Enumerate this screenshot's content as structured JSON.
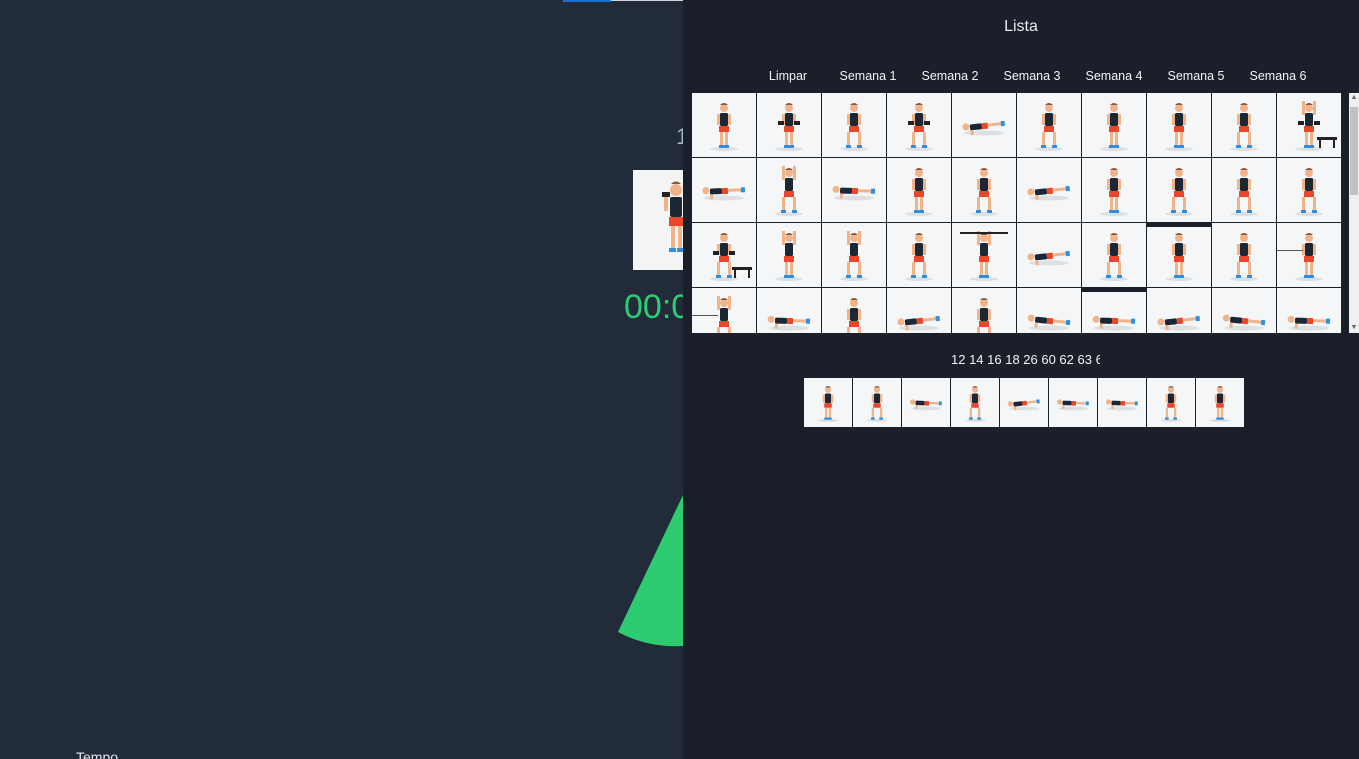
{
  "background": {
    "counter_text": "1",
    "timer_text": "00:0",
    "tempo_label": "Tempo",
    "accent_color": "#2ecc71"
  },
  "panel": {
    "title": "Lista",
    "week_tabs": [
      "Limpar",
      "Semana 1",
      "Semana 2",
      "Semana 3",
      "Semana 4",
      "Semana 5",
      "Semana 6"
    ],
    "selected_ids_text": "12 14 16 18 26 60 62 63 6",
    "exercise_grid": [
      [
        "squat-dumbbells",
        "sumo-squat",
        "shoulder-press",
        "weight-plate-squat",
        "floor-stretch",
        "dumbbell-side-raise",
        "kettlebell-squat",
        "one-arm-press",
        "arms-crossed-stand",
        "bench-step"
      ],
      [
        "crunch",
        "dumbbell-curl",
        "plank",
        "weight-plate-hold",
        "overhead-press",
        "side-plank",
        "bent-over-row",
        "jumping-jack",
        "wide-stance-stretch",
        "arm-raise-stand"
      ],
      [
        "bench-lunge",
        "walking-lunge",
        "knee-raise",
        "standing-side",
        "barbell-overhead",
        "side-lunge-floor",
        "bent-stand",
        "deadlift",
        "arm-circles",
        "band-pull"
      ],
      [
        "cable-stand",
        "floor-roll",
        "overhead-stretch",
        "plank-reach",
        "standing-stretch",
        "incline-plank",
        "push-up",
        "leg-raise-floor",
        "prone-lie",
        "push-up-wide"
      ]
    ],
    "selected_exercises": [
      "squat-dumbbells",
      "standing-side",
      "plank",
      "jumping-jack",
      "side-plank",
      "sit-stretch",
      "floor-crunch",
      "arm-circles",
      "lateral-stretch"
    ]
  },
  "colors": {
    "panel_bg": "#1a1f29",
    "page_bg": "#212b3a",
    "tile_bg": "#f5f6f7",
    "shirt": "#1d2733",
    "shorts": "#e8472a",
    "skin": "#f0b48a",
    "shoes": "#2f8fde"
  }
}
